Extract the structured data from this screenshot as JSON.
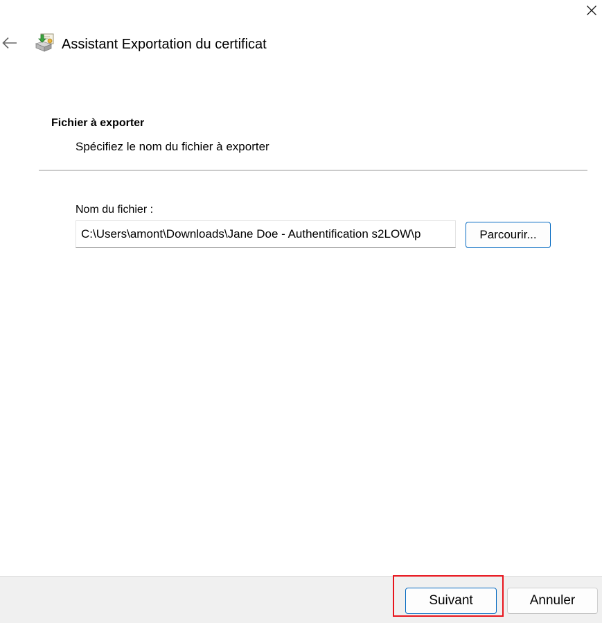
{
  "window": {
    "title": "Assistant Exportation du certificat",
    "close_icon": "close-icon",
    "back_icon": "back-arrow-icon",
    "title_icon": "certificate-export-icon"
  },
  "section": {
    "heading": "Fichier à exporter",
    "subtitle": "Spécifiez le nom du fichier à exporter"
  },
  "file": {
    "label": "Nom du fichier :",
    "value": "C:\\Users\\amont\\Downloads\\Jane Doe - Authentification s2LOW\\p",
    "browse_label": "Parcourir..."
  },
  "footer": {
    "next_label": "Suivant",
    "cancel_label": "Annuler"
  },
  "colors": {
    "accent": "#0067c0",
    "highlight": "#e8141c",
    "footer_bg": "#f0f0f0"
  }
}
